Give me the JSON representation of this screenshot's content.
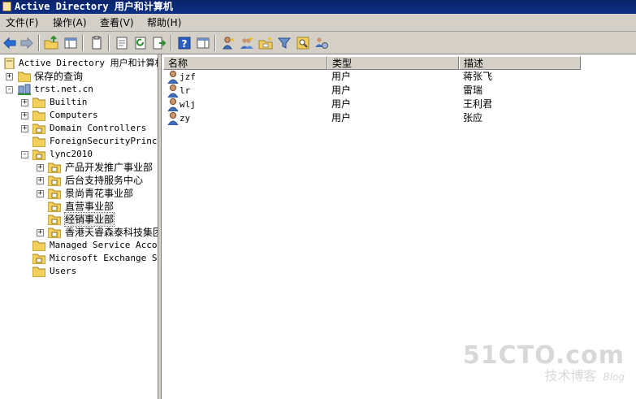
{
  "window": {
    "title": "Active Directory 用户和计算机"
  },
  "menu": [
    {
      "label": "文件(F)"
    },
    {
      "label": "操作(A)"
    },
    {
      "label": "查看(V)"
    },
    {
      "label": "帮助(H)"
    }
  ],
  "toolbar_icons": [
    "back-arrow-icon",
    "forward-arrow-icon",
    "up-folder-icon",
    "show-tree-icon",
    "copy-icon",
    "properties-icon",
    "refresh-icon",
    "export-list-icon",
    "help-icon",
    "action-pane-icon",
    "new-user-icon",
    "new-group-icon",
    "new-ou-icon",
    "filter-icon",
    "find-icon",
    "add-to-group-icon"
  ],
  "tree": {
    "root": "Active Directory 用户和计算机",
    "saved_queries": "保存的查询",
    "domain": "trst.net.cn",
    "items": [
      {
        "label": "Builtin",
        "expander": "+"
      },
      {
        "label": "Computers",
        "expander": "+"
      },
      {
        "label": "Domain Controllers",
        "expander": "+"
      },
      {
        "label": "ForeignSecurityPrincip",
        "expander": ""
      },
      {
        "label": "lync2010",
        "expander": "-"
      },
      {
        "label": "Managed Service Accour",
        "expander": ""
      },
      {
        "label": "Microsoft Exchange Sec",
        "expander": ""
      },
      {
        "label": "Users",
        "expander": ""
      }
    ],
    "lync_children": [
      {
        "label": "产品开发推广事业部",
        "expander": "+"
      },
      {
        "label": "后台支持服务中心",
        "expander": "+"
      },
      {
        "label": "景尚青花事业部",
        "expander": "+"
      },
      {
        "label": "直营事业部",
        "expander": ""
      },
      {
        "label": "经销事业部",
        "expander": "",
        "selected": true
      },
      {
        "label": "香港天睿森泰科技集团",
        "expander": "+"
      }
    ]
  },
  "list": {
    "columns": [
      "名称",
      "类型",
      "描述"
    ],
    "rows": [
      {
        "name": "jzf",
        "type": "用户",
        "desc": "蒋张飞"
      },
      {
        "name": "lr",
        "type": "用户",
        "desc": "雷瑞"
      },
      {
        "name": "wlj",
        "type": "用户",
        "desc": "王利君"
      },
      {
        "name": "zy",
        "type": "用户",
        "desc": "张应"
      }
    ]
  },
  "watermark": {
    "main": "51CTO.com",
    "sub": "技术博客",
    "blog": "Blog"
  }
}
